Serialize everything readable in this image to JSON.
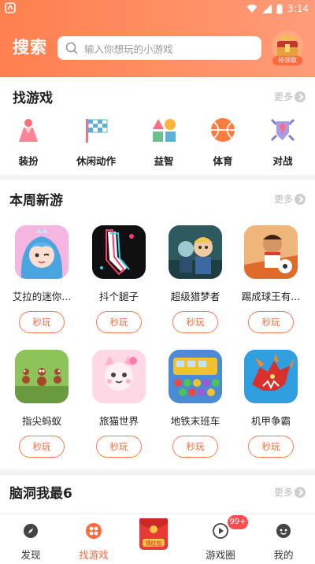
{
  "statusbar": {
    "time": "3:14"
  },
  "header": {
    "title": "搜索",
    "search_placeholder": "输入你想玩的小游戏",
    "gift_badge": "待领取"
  },
  "find_games": {
    "title": "找游戏",
    "more": "更多",
    "categories": [
      {
        "label": "装扮",
        "icon": "dress-icon"
      },
      {
        "label": "休闲动作",
        "icon": "flag-icon"
      },
      {
        "label": "益智",
        "icon": "shapes-icon"
      },
      {
        "label": "体育",
        "icon": "ball-icon"
      },
      {
        "label": "对战",
        "icon": "shield-icon"
      }
    ]
  },
  "new_games": {
    "title": "本周新游",
    "more": "更多",
    "play_label": "秒玩",
    "games": [
      {
        "name": "艾拉的迷你...",
        "icon": "princess-icon"
      },
      {
        "name": "抖个腿子",
        "icon": "leg-icon"
      },
      {
        "name": "超级猎梦者",
        "icon": "hunter-icon"
      },
      {
        "name": "踢成球王有...",
        "icon": "football-icon"
      },
      {
        "name": "指尖蚂蚁",
        "icon": "ants-icon"
      },
      {
        "name": "旅猫世界",
        "icon": "cat-icon"
      },
      {
        "name": "地铁末班车",
        "icon": "bus-icon"
      },
      {
        "name": "机甲争霸",
        "icon": "dragon-icon"
      }
    ]
  },
  "brain": {
    "title": "脑洞我最6",
    "more": "更多"
  },
  "nav": {
    "items": [
      {
        "label": "发现"
      },
      {
        "label": "找游戏"
      },
      {
        "label": "领红包"
      },
      {
        "label": "游戏圈"
      },
      {
        "label": "我的"
      }
    ],
    "badge": "99+"
  },
  "colors": {
    "accent": "#ff6a3d",
    "header_start": "#ff7f4f",
    "header_end": "#ff9b79"
  }
}
